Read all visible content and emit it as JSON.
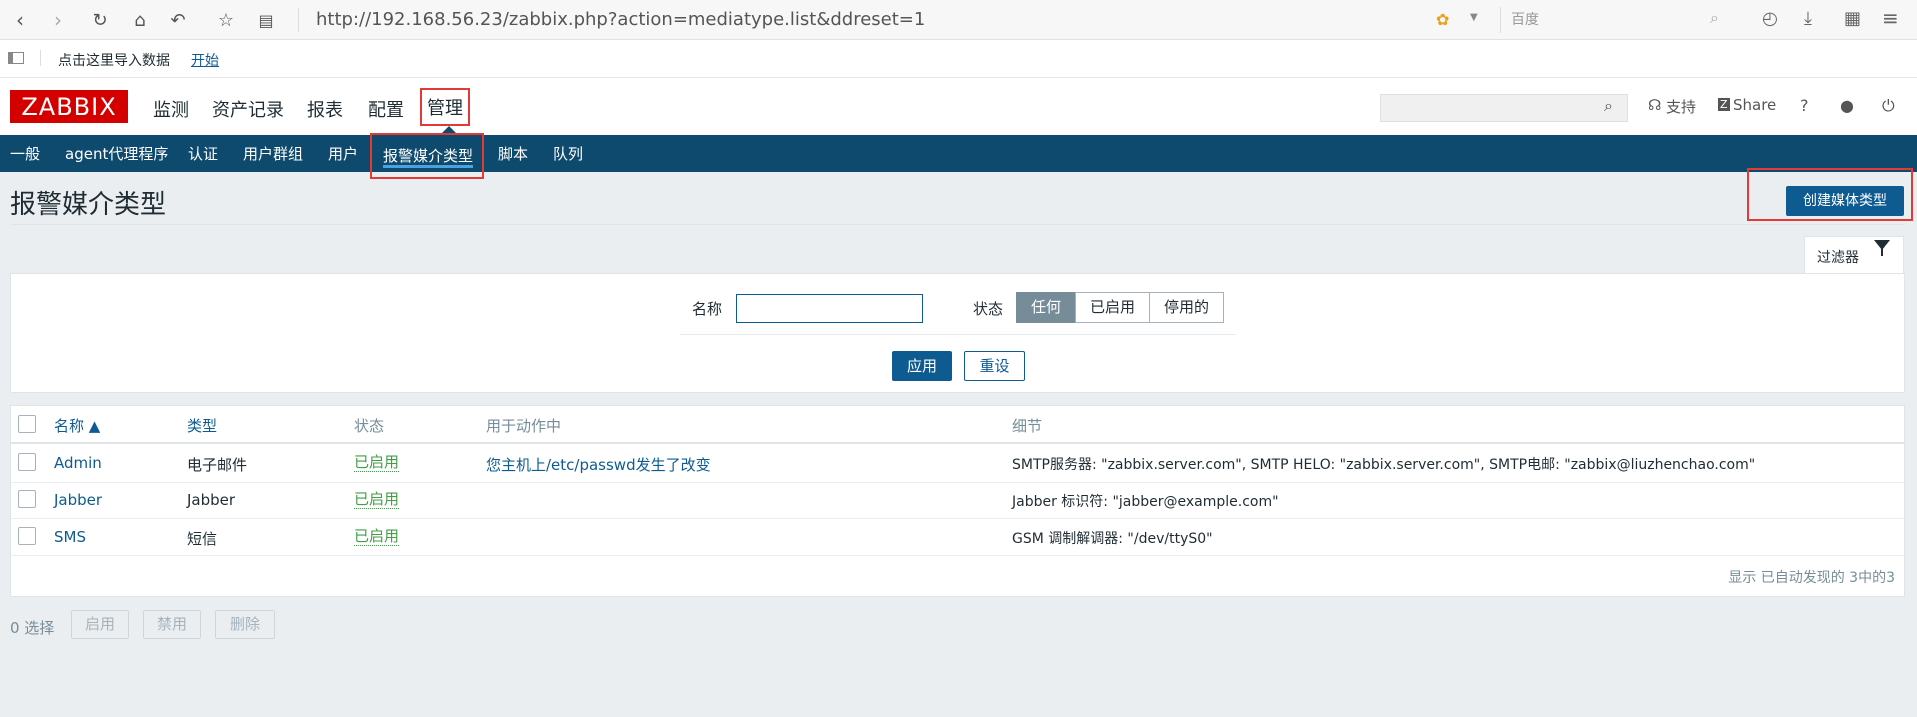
{
  "browser": {
    "url": "http://192.168.56.23/zabbix.php?action=mediatype.list&ddreset=1",
    "search_placeholder": "百度",
    "bookmark_text": "点击这里导入数据",
    "bookmark_link": "开始"
  },
  "header": {
    "logo": "ZABBIX",
    "menu": [
      "监测",
      "资产记录",
      "报表",
      "配置",
      "管理"
    ],
    "support": "支持",
    "share": "Share",
    "help": "?"
  },
  "subnav": [
    "一般",
    "agent代理程序",
    "认证",
    "用户群组",
    "用户",
    "报警媒介类型",
    "脚本",
    "队列"
  ],
  "page": {
    "title": "报警媒介类型",
    "create_button": "创建媒体类型"
  },
  "filter": {
    "tab_label": "过滤器",
    "name_label": "名称",
    "name_value": "",
    "status_label": "状态",
    "status_options": [
      "任何",
      "已启用",
      "停用的"
    ],
    "apply": "应用",
    "reset": "重设"
  },
  "table": {
    "headers": [
      "名称 ▲",
      "类型",
      "状态",
      "用于动作中",
      "细节"
    ],
    "rows": [
      {
        "name": "Admin",
        "type": "电子邮件",
        "status": "已启用",
        "used_in": "您主机上/etc/passwd发生了改变",
        "details": "SMTP服务器: \"zabbix.server.com\", SMTP HELO: \"zabbix.server.com\", SMTP电邮: \"zabbix@liuzhenchao.com\""
      },
      {
        "name": "Jabber",
        "type": "Jabber",
        "status": "已启用",
        "used_in": "",
        "details": "Jabber 标识符: \"jabber@example.com\""
      },
      {
        "name": "SMS",
        "type": "短信",
        "status": "已启用",
        "used_in": "",
        "details": "GSM 调制解调器: \"/dev/ttyS0\""
      }
    ],
    "footer": "显示 已自动发现的 3中的3"
  },
  "mass": {
    "selected": "0 选择",
    "enable": "启用",
    "disable": "禁用",
    "delete": "删除"
  },
  "colors": {
    "nav_bg": "#0e4a6e",
    "primary": "#0e5b92",
    "enabled": "#429e47",
    "highlight": "#e53935",
    "logo": "#d40000"
  }
}
